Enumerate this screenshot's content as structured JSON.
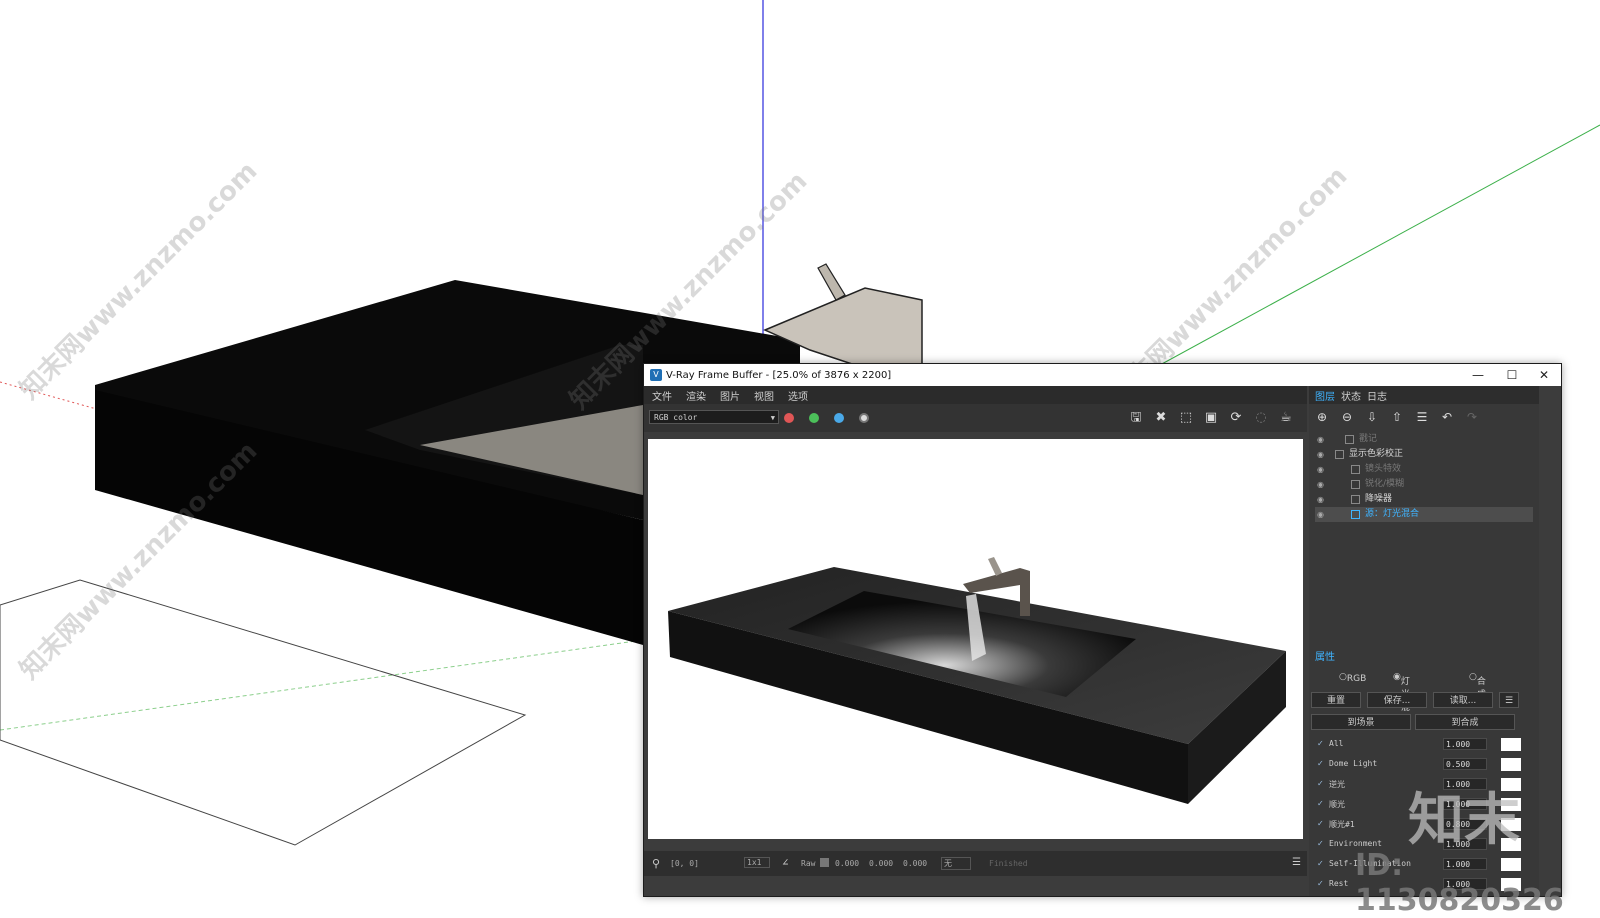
{
  "vfb": {
    "title": "V-Ray Frame Buffer - [25.0% of 3876 x 2200]",
    "window_buttons": {
      "minimize": "—",
      "maximize": "☐",
      "close": "✕"
    },
    "menu": [
      "文件",
      "渲染",
      "图片",
      "视图",
      "选项"
    ],
    "channel_select": "RGB color",
    "colors": {
      "red": "#e05656",
      "green": "#4cc05a",
      "blue": "#4aa9e8"
    },
    "status": {
      "coords": "[0, 0]",
      "zoom": "1x1",
      "raw": "Raw",
      "r": "0.000",
      "g": "0.000",
      "b": "0.000",
      "lut": "无",
      "state": "Finished"
    }
  },
  "panel": {
    "tabs": [
      "图层",
      "状态",
      "日志"
    ],
    "layers": [
      {
        "label": "戳记",
        "visible": false
      },
      {
        "label": "显示色彩校正",
        "visible": false
      },
      {
        "label": "镜头特效",
        "visible": false
      },
      {
        "label": "锐化/模糊",
        "visible": false
      },
      {
        "label": "降噪器",
        "visible": true
      },
      {
        "label": "源：灯光混合",
        "visible": true
      }
    ],
    "properties_title": "属性",
    "mode_options": [
      "RGB",
      "灯光混合",
      "合成"
    ],
    "mode_selected": "灯光混合",
    "buttons": {
      "reset": "重置",
      "save": "保存...",
      "load": "读取...",
      "to_scene": "到场景",
      "to_composite": "到合成"
    },
    "lightmix": [
      {
        "name": "All",
        "value": "1.000"
      },
      {
        "name": "Dome Light",
        "value": "0.500"
      },
      {
        "name": "逆光",
        "value": "1.000"
      },
      {
        "name": "顺光",
        "value": "1.000"
      },
      {
        "name": "顺光#1",
        "value": "0.800"
      },
      {
        "name": "Environment",
        "value": "1.000"
      },
      {
        "name": "Self-Illumination",
        "value": "1.000"
      },
      {
        "name": "Rest",
        "value": "1.000"
      }
    ]
  },
  "watermarks": {
    "site": "知末网www.znzmo.com",
    "brand": "知末",
    "id": "ID: 1130820326"
  }
}
